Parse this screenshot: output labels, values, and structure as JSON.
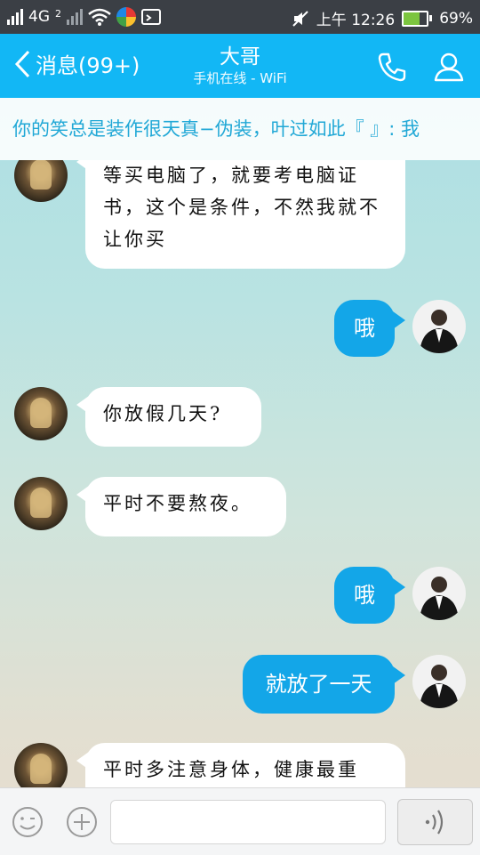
{
  "status_bar": {
    "network": "4G",
    "sim2": "2",
    "time": "上午 12:26",
    "battery": "69%",
    "battery_level": 0.69
  },
  "header": {
    "back_label": "消息(99+)",
    "contact_name": "大哥",
    "contact_status": "手机在线 - WiFi"
  },
  "notice": {
    "text": "你的笑总是装作很天真−伪装，叶过如此『 』: 我"
  },
  "messages": [
    {
      "from": "other",
      "text": "等买电脑了，就要考电脑证书，这个是条件，不然我就不让你买"
    },
    {
      "from": "me",
      "text": "哦"
    },
    {
      "from": "other",
      "text": "你放假几天?"
    },
    {
      "from": "other",
      "text": "平时不要熬夜。"
    },
    {
      "from": "me",
      "text": "哦"
    },
    {
      "from": "me",
      "text": "就放了一天"
    },
    {
      "from": "other",
      "text": "平时多注意身体，健康最重"
    }
  ],
  "input": {
    "placeholder": ""
  },
  "colors": {
    "header": "#12b7f5",
    "status_bar": "#3b3f45",
    "outgoing_bubble": "#13a6e8",
    "incoming_bubble": "#ffffff",
    "notice_text": "#21a8d6"
  }
}
